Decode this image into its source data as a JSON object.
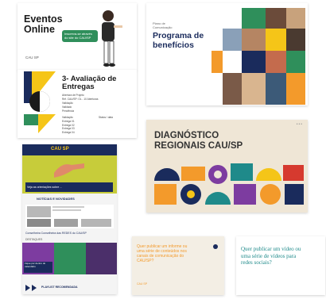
{
  "colors": {
    "green": "#2f8f5b",
    "teal": "#1f8a8a",
    "orange": "#f39a2b",
    "navy": "#1a2b5c",
    "yellow": "#f5c518",
    "purple": "#7d3ca0",
    "red": "#d63a2f",
    "beige": "#efe6d6",
    "cream": "#f3eee4"
  },
  "thumbnails": [
    {
      "title": "Eventos\nOnline",
      "badge_text": "Inscreva-se através do site do CAU/SP",
      "logo": "CAU SP"
    },
    {
      "eyebrow": "Plano de\nComunicação",
      "title": "Programa de\nbenefícios"
    },
    {
      "title": "3- Avaliação de\nEntregas",
      "rows": [
        "Abertura de Projeto",
        "Ref. CAU/SP: OL - 10 Aberturas",
        "Validação",
        "Validado",
        "Pendência"
      ],
      "col_head_1": "Validação",
      "col_head_2": "Status / data",
      "col_rows": [
        "Entrega 01",
        "Entrega 02",
        "Entrega 03",
        "Entrega 04"
      ]
    },
    {
      "title": "DIAGNÓSTICO\nREGIONAIS CAU/SP"
    },
    {
      "header_logo": "CAU SP",
      "banner_caption": "Veja as orientações sobre ...",
      "section_label": "NOTÍCIAS E NOVIDADES",
      "mid_caption": "Conselheira Conselheira das REDES do CAU/SP",
      "row_label": "DESTAQUES",
      "caption_2": "Fique por dentro do calendário",
      "footer_label": "PLAYLIST RECOMENDADA"
    },
    {
      "question": "Quer publicar um informe ou uma série de conteúdos nos canais de comunicação do CAU/SP?",
      "logo": "CAU SP"
    },
    {
      "question": "Quer publicar um vídeo ou uma série de vídeos para redes sociais?"
    }
  ]
}
